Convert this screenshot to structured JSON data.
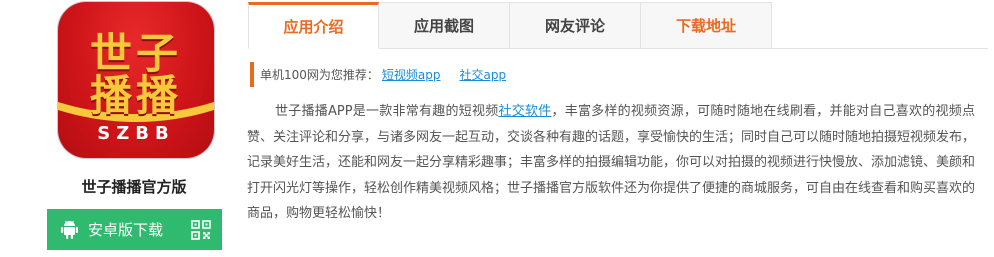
{
  "app": {
    "icon_text_line1": "世子",
    "icon_text_line2": "播播",
    "icon_letters": "SZBB",
    "name": "世子播播官方版"
  },
  "download": {
    "label": "安卓版下载",
    "android_icon": "android-icon",
    "qr_icon": "qr-code-icon",
    "color": "#2fba6f"
  },
  "tabs": [
    {
      "label": "应用介绍",
      "active": true
    },
    {
      "label": "应用截图",
      "active": false
    },
    {
      "label": "网友评论",
      "active": false
    },
    {
      "label": "下载地址",
      "active": false
    }
  ],
  "recommend": {
    "prefix": "单机100网为您推荐：",
    "links": [
      "短视频app",
      "社交app"
    ]
  },
  "description": {
    "part1": "世子播播APP是一款非常有趣的短视频",
    "link": "社交软件",
    "part2": "，丰富多样的视频资源，可随时随地在线刷看，并能对自己喜欢的视频点赞、关注评论和分享，与诸多网友一起互动，交谈各种有趣的话题，享受愉快的生活；同时自己可以随时随地拍摄短视频发布，记录美好生活，还能和网友一起分享精彩趣事；丰富多样的拍摄编辑功能，你可以对拍摄的视频进行快慢放、添加滤镜、美颜和打开闪光灯等操作，轻松创作精美视频风格；世子播播官方版软件还为你提供了便捷的商城服务，可自由在线查看和购买喜欢的商品，购物更轻松愉快！"
  },
  "colors": {
    "accent": "#ec6a1f",
    "link": "#1a8cd8",
    "icon_red": "#cf1519",
    "icon_gold": "#f6c83c"
  }
}
